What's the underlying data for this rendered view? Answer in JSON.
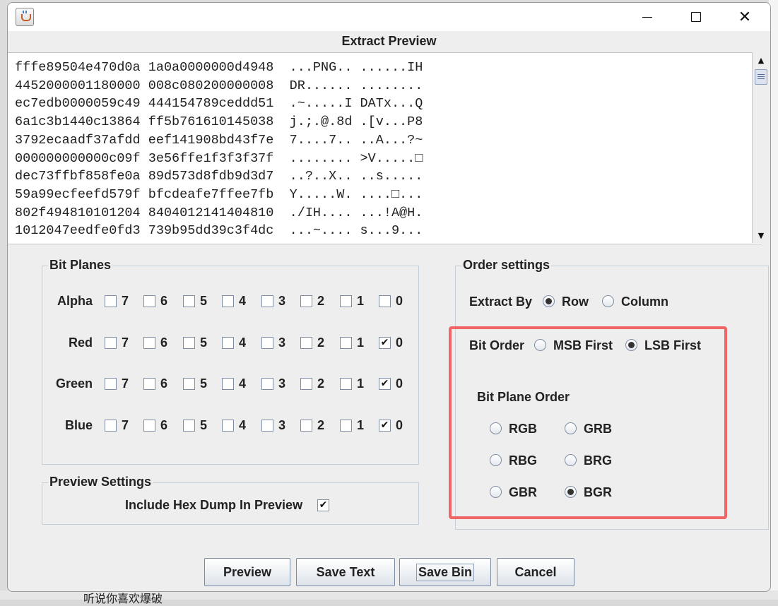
{
  "dialog_title": "Extract Preview",
  "preview": {
    "hex_col1": [
      "fffe89504e470d0a",
      "4452000001180000",
      "ec7edb0000059c49",
      "6a1c3b1440c13864",
      "3792ecaadf37afdd",
      "000000000000c09f",
      "dec73ffbf858fe0a",
      "59a99ecfeefd579f",
      "802f494810101204",
      "1012047eedfe0fd3"
    ],
    "hex_col2": [
      "1a0a0000000d4948",
      "008c080200000008",
      "444154789ceddd51",
      "ff5b761610145038",
      "eef141908bd43f7e",
      "3e56ffe1f3f3f37f",
      "89d573d8fdb9d3d7",
      "bfcdeafe7ffee7fb",
      "8404012141404810",
      "739b95dd39c3f4dc"
    ],
    "ascii_col1": [
      "...PNG..",
      "DR......",
      ".~.....I",
      "j.;.@.8d",
      "7....7..",
      "........",
      "..?..X..",
      "Y.....W.",
      "./IH....",
      "...~...."
    ],
    "ascii_col2": [
      "......IH",
      "........",
      "DATx...Q",
      ".[v...P8",
      "..A...?~",
      ">V.....□",
      "..s.....",
      "....□...",
      "...!A@H.",
      "s...9..."
    ]
  },
  "bit_planes": {
    "title": "Bit Planes",
    "rows": [
      {
        "label": "Alpha",
        "bits": [
          "7",
          "6",
          "5",
          "4",
          "3",
          "2",
          "1",
          "0"
        ],
        "checked": [
          false,
          false,
          false,
          false,
          false,
          false,
          false,
          false
        ]
      },
      {
        "label": "Red",
        "bits": [
          "7",
          "6",
          "5",
          "4",
          "3",
          "2",
          "1",
          "0"
        ],
        "checked": [
          false,
          false,
          false,
          false,
          false,
          false,
          false,
          true
        ]
      },
      {
        "label": "Green",
        "bits": [
          "7",
          "6",
          "5",
          "4",
          "3",
          "2",
          "1",
          "0"
        ],
        "checked": [
          false,
          false,
          false,
          false,
          false,
          false,
          false,
          true
        ]
      },
      {
        "label": "Blue",
        "bits": [
          "7",
          "6",
          "5",
          "4",
          "3",
          "2",
          "1",
          "0"
        ],
        "checked": [
          false,
          false,
          false,
          false,
          false,
          false,
          false,
          true
        ]
      }
    ]
  },
  "preview_settings": {
    "title": "Preview Settings",
    "include_hex_label": "Include Hex Dump In Preview",
    "include_hex_checked": true
  },
  "order_settings": {
    "title": "Order settings",
    "extract_by_label": "Extract By",
    "extract_by_options": [
      "Row",
      "Column"
    ],
    "extract_by_selected": "Row",
    "bit_order_label": "Bit Order",
    "bit_order_options": [
      "MSB First",
      "LSB First"
    ],
    "bit_order_selected": "LSB First",
    "bit_plane_order_label": "Bit Plane Order",
    "bit_plane_order_options": [
      "RGB",
      "GRB",
      "RBG",
      "BRG",
      "GBR",
      "BGR"
    ],
    "bit_plane_order_selected": "BGR"
  },
  "buttons": {
    "preview": "Preview",
    "save_text": "Save Text",
    "save_bin": "Save Bin",
    "cancel": "Cancel"
  },
  "background": {
    "bottom_text": "听说你喜欢爆破"
  },
  "check_mark": "✔",
  "colors": {
    "highlight": "#f06666",
    "dialog_bg": "#eeeeee",
    "preview_bg": "#ffffff"
  }
}
